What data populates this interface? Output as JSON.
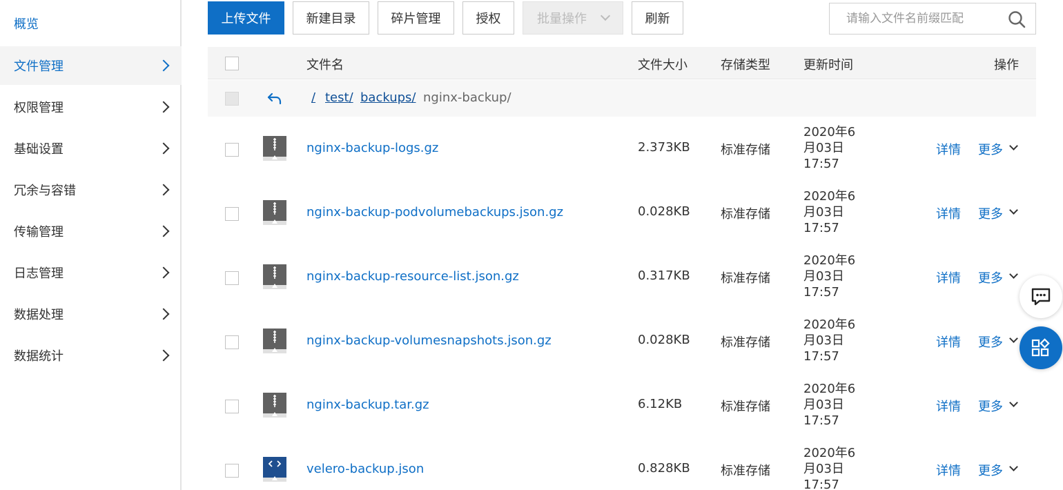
{
  "sidebar": {
    "items": [
      {
        "label": "概览"
      },
      {
        "label": "文件管理"
      },
      {
        "label": "权限管理"
      },
      {
        "label": "基础设置"
      },
      {
        "label": "冗余与容错"
      },
      {
        "label": "传输管理"
      },
      {
        "label": "日志管理"
      },
      {
        "label": "数据处理"
      },
      {
        "label": "数据统计"
      }
    ]
  },
  "toolbar": {
    "upload": "上传文件",
    "new_dir": "新建目录",
    "fragments": "碎片管理",
    "authorize": "授权",
    "batch": "批量操作",
    "refresh": "刷新"
  },
  "search": {
    "placeholder": "请输入文件名前缀匹配",
    "value": ""
  },
  "table": {
    "headers": {
      "name": "文件名",
      "size": "文件大小",
      "type": "存储类型",
      "time": "更新时间",
      "ops": "操作"
    },
    "path": {
      "root": "/",
      "seg1": "test/",
      "seg2": "backups/",
      "current": "nginx-backup/"
    },
    "rows": [
      {
        "name": "nginx-backup-logs.gz",
        "size": "2.373KB",
        "type": "标准存储",
        "time": "2020年6月03日 17:57",
        "detail": "详情",
        "more": "更多",
        "icon": "archive-icon"
      },
      {
        "name": "nginx-backup-podvolumebackups.json.gz",
        "size": "0.028KB",
        "type": "标准存储",
        "time": "2020年6月03日 17:57",
        "detail": "详情",
        "more": "更多",
        "icon": "archive-icon"
      },
      {
        "name": "nginx-backup-resource-list.json.gz",
        "size": "0.317KB",
        "type": "标准存储",
        "time": "2020年6月03日 17:57",
        "detail": "详情",
        "more": "更多",
        "icon": "archive-icon"
      },
      {
        "name": "nginx-backup-volumesnapshots.json.gz",
        "size": "0.028KB",
        "type": "标准存储",
        "time": "2020年6月03日 17:57",
        "detail": "详情",
        "more": "更多",
        "icon": "archive-icon"
      },
      {
        "name": "nginx-backup.tar.gz",
        "size": "6.12KB",
        "type": "标准存储",
        "time": "2020年6月03日 17:57",
        "detail": "详情",
        "more": "更多",
        "icon": "archive-icon"
      },
      {
        "name": "velero-backup.json",
        "size": "0.828KB",
        "type": "标准存储",
        "time": "2020年6月03日 17:57",
        "detail": "详情",
        "more": "更多",
        "icon": "code-file-icon"
      }
    ]
  },
  "colors": {
    "primary": "#0f6fc6",
    "link": "#0f4f96",
    "archive_icon": "#616161",
    "code_icon": "#1f4f8f"
  }
}
